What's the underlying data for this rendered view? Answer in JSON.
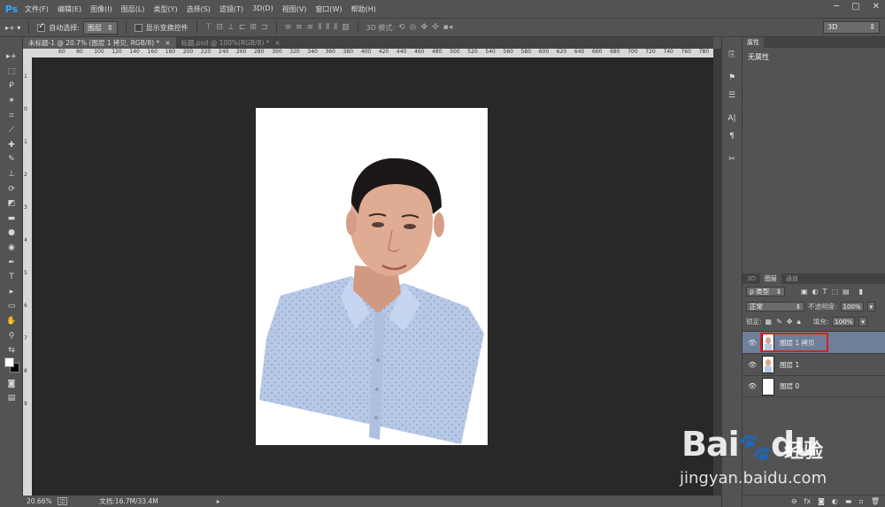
{
  "app": {
    "logo": "Ps"
  },
  "menu": [
    "文件(F)",
    "编辑(E)",
    "图像(I)",
    "图层(L)",
    "类型(Y)",
    "选择(S)",
    "滤镜(T)",
    "3D(D)",
    "视图(V)",
    "窗口(W)",
    "帮助(H)"
  ],
  "window_buttons": [
    "─",
    "□",
    "✕"
  ],
  "options": {
    "auto_select_label": "自动选择:",
    "auto_select_value": "图层",
    "show_transform_label": "显示变换控件",
    "mode_3d_label": "3D 模式:",
    "workspace": "3D"
  },
  "tabs": [
    {
      "label": "未标题-1 @ 20.7% (图层 1 拷贝, RGB/8) *",
      "close": "×"
    },
    {
      "label": "标题.psd @ 100%(RGB/8) *",
      "close": "×"
    }
  ],
  "ruler_top": [
    "60",
    "80",
    "100",
    "120",
    "140",
    "160",
    "180",
    "200",
    "220",
    "240",
    "260",
    "280",
    "300",
    "320",
    "340",
    "360",
    "380",
    "400",
    "420",
    "440",
    "460",
    "480",
    "500",
    "520",
    "540",
    "560",
    "580",
    "600",
    "620",
    "640",
    "660",
    "680",
    "700",
    "720",
    "740",
    "760",
    "780"
  ],
  "ruler_left": [
    "1",
    "0",
    "1",
    "2",
    "3",
    "4",
    "5",
    "6",
    "7",
    "8",
    "9"
  ],
  "status": {
    "zoom": "20.66%",
    "doc": "文档:16.7M/33.4M"
  },
  "properties": {
    "tab": "属性",
    "body": "无属性"
  },
  "layers_panel": {
    "tabs": [
      "3D",
      "图层",
      "通道"
    ],
    "filter": "ρ 类型",
    "blend_mode": "正常",
    "opacity_label": "不透明度:",
    "opacity_value": "100%",
    "lock_label": "锁定:",
    "fill_label": "填充:",
    "fill_value": "100%",
    "layers": [
      {
        "name": "图层 1 拷贝",
        "selected": true
      },
      {
        "name": "图层 1",
        "selected": false
      },
      {
        "name": "图层 0",
        "selected": false
      }
    ]
  },
  "watermark": {
    "brand": "Bai",
    "brand2": "du",
    "cn": "经验",
    "url": "jingyan.baidu.com"
  },
  "colors": {
    "accent": "#31a8ff",
    "selection": "#6e7f99",
    "highlight": "#e21c1c"
  }
}
